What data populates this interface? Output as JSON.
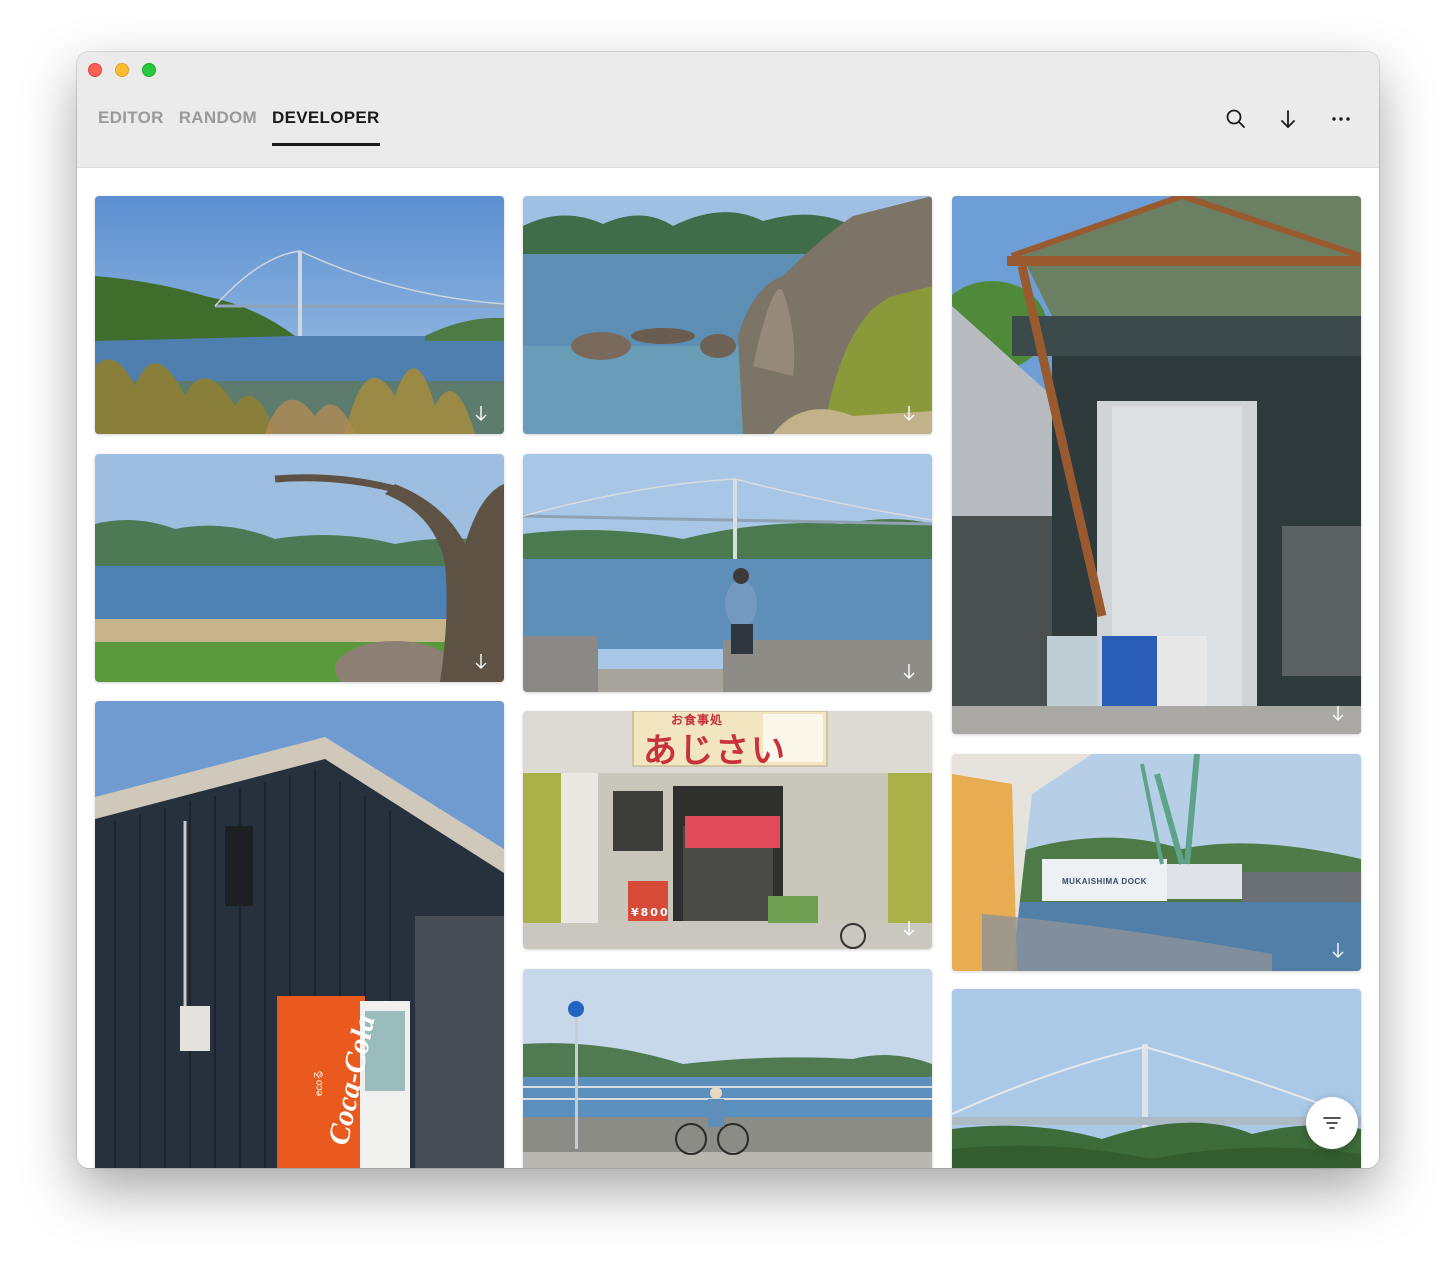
{
  "window": {
    "controls": [
      "close",
      "minimize",
      "zoom"
    ]
  },
  "tabs": [
    {
      "label": "EDITOR",
      "active": false
    },
    {
      "label": "RANDOM",
      "active": false
    },
    {
      "label": "DEVELOPER",
      "active": true
    }
  ],
  "toolbar": {
    "search_icon": "search-icon",
    "download_icon": "download-icon",
    "more_icon": "more-icon"
  },
  "photos": [
    {
      "id": "bridge-over-sea",
      "download_icon": "download-icon"
    },
    {
      "id": "rocky-coast",
      "download_icon": "download-icon"
    },
    {
      "id": "shipyard-shed",
      "download_icon": "download-icon"
    },
    {
      "id": "tree-by-sea",
      "download_icon": "download-icon"
    },
    {
      "id": "man-facing-bridge",
      "download_icon": "download-icon"
    },
    {
      "id": "coca-cola-machine"
    },
    {
      "id": "ajisai-restaurant",
      "download_icon": "download-icon"
    },
    {
      "id": "mukaishima-dock",
      "download_icon": "download-icon"
    },
    {
      "id": "cyclist-seawall"
    },
    {
      "id": "bridge-over-hills"
    }
  ],
  "signs": {
    "restaurant_title": "あじさい",
    "restaurant_top": "お食事処",
    "restaurant_price": "¥800",
    "dock_name": "MUKAISHIMA DOCK",
    "vending_brand": "Coca-Cola",
    "vending_eco": "ecoる"
  },
  "fab": {
    "icon": "filter-icon"
  },
  "colors": {
    "titlebar": "#ebebeb",
    "tab_active": "#1b1b1b",
    "tab_inactive": "#9a9a9a",
    "close": "#fe5f57",
    "minimize": "#febc2e",
    "zoom": "#28c840"
  }
}
